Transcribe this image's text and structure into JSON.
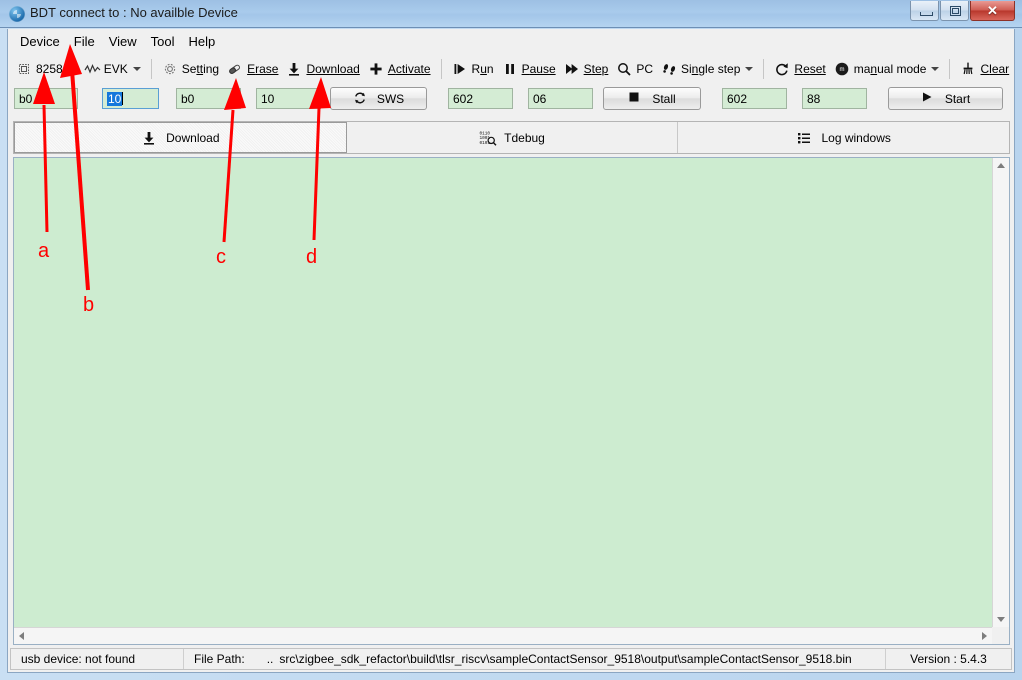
{
  "window": {
    "title": "BDT connect to : No availble Device",
    "icon": "bdt-app-icon",
    "controls": {
      "minimize": "minimize-icon",
      "maximize": "maximize-icon",
      "close": "close-icon"
    }
  },
  "menubar": {
    "items": [
      {
        "label": "Device"
      },
      {
        "label": "File"
      },
      {
        "label": "View"
      },
      {
        "label": "Tool"
      },
      {
        "label": "Help"
      }
    ]
  },
  "toolbar": {
    "items": [
      {
        "label": "8258",
        "icon": "chip-icon",
        "dropdown": true
      },
      {
        "label": "EVK",
        "icon": "waveform-icon",
        "dropdown": true
      },
      {
        "separator": true
      },
      {
        "label": "Setting",
        "icon": "gear-icon",
        "dropdown": false
      },
      {
        "label": "Erase",
        "icon": "eraser-icon",
        "dropdown": false
      },
      {
        "label": "Download",
        "icon": "download-arrow-icon",
        "dropdown": false
      },
      {
        "label": "Activate",
        "icon": "plus-icon",
        "dropdown": false
      },
      {
        "separator": true
      },
      {
        "label": "Run",
        "icon": "run-icon",
        "dropdown": false
      },
      {
        "label": "Pause",
        "icon": "pause-icon",
        "dropdown": false
      },
      {
        "label": "Step",
        "icon": "step-icon",
        "dropdown": false
      },
      {
        "label": "PC",
        "icon": "magnifier-icon",
        "dropdown": false
      },
      {
        "label": "Single step",
        "icon": "footsteps-icon",
        "dropdown": true
      },
      {
        "separator": true
      },
      {
        "label": "Reset",
        "icon": "reset-circular-arrow-icon",
        "dropdown": false
      },
      {
        "label": "manual mode",
        "icon": "manual-mode-icon",
        "dropdown": true
      },
      {
        "separator": true
      },
      {
        "label": "Clear",
        "icon": "broom-icon",
        "dropdown": false
      }
    ]
  },
  "fields": {
    "addr1": {
      "value": "b0",
      "focused": false
    },
    "len1": {
      "value": "10",
      "focused": true,
      "selected": true
    },
    "addr2": {
      "value": "b0",
      "focused": false
    },
    "len2": {
      "value": "10",
      "focused": false
    },
    "sws_button": {
      "label": "SWS",
      "icon": "refresh-icon"
    },
    "val1": {
      "value": "602",
      "focused": false
    },
    "val2": {
      "value": "06",
      "focused": false
    },
    "stall_button": {
      "label": "Stall",
      "icon": "stop-square-icon"
    },
    "val3": {
      "value": "602",
      "focused": false
    },
    "val4": {
      "value": "88",
      "focused": false
    },
    "start_button": {
      "label": "Start",
      "icon": "play-triangle-icon"
    }
  },
  "tabs": [
    {
      "label": "Download",
      "icon": "download-arrow-icon",
      "active": true
    },
    {
      "label": "Tdebug",
      "icon": "binary-magnifier-icon",
      "active": false
    },
    {
      "label": "Log windows",
      "icon": "list-lines-icon",
      "active": false
    }
  ],
  "content": {
    "text": "",
    "background_color": "#cdecd0"
  },
  "statusbar": {
    "usb_status": "usb device: not found",
    "file_path_label": "File Path:",
    "file_path_prefix": "..",
    "file_path": "src\\zigbee_sdk_refactor\\build\\tlsr_riscv\\sampleContactSensor_9518\\output\\sampleContactSensor_9518.bin",
    "version": "Version : 5.4.3"
  },
  "annotations": {
    "color": "#ff0000",
    "markers": [
      {
        "id": "a",
        "label": "a",
        "target": "chip-8258-dropdown"
      },
      {
        "id": "b",
        "label": "b",
        "target": "menu-file"
      },
      {
        "id": "c",
        "label": "c",
        "target": "erase-button"
      },
      {
        "id": "d",
        "label": "d",
        "target": "download-button"
      }
    ]
  }
}
